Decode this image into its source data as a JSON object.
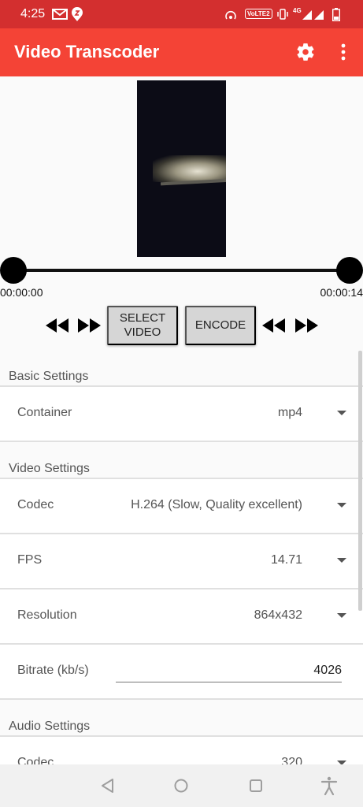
{
  "status_bar": {
    "time": "4:25",
    "volte_badge": "VoLTE2",
    "network_label": "4G"
  },
  "app_bar": {
    "title": "Video Transcoder",
    "settings_icon": "gear-icon",
    "overflow_icon": "more-vert-icon"
  },
  "player": {
    "start_time": "00:00:00",
    "end_time": "00:00:14"
  },
  "controls": {
    "select_video": "SELECT\nVIDEO",
    "encode": "ENCODE"
  },
  "basic_settings": {
    "header": "Basic Settings",
    "container": {
      "label": "Container",
      "value": "mp4"
    }
  },
  "video_settings": {
    "header": "Video Settings",
    "codec": {
      "label": "Codec",
      "value": "H.264 (Slow, Quality excellent)"
    },
    "fps": {
      "label": "FPS",
      "value": "14.71"
    },
    "resolution": {
      "label": "Resolution",
      "value": "864x432"
    },
    "bitrate": {
      "label": "Bitrate (kb/s)",
      "value": "4026"
    }
  },
  "audio_settings": {
    "header": "Audio Settings",
    "codec": {
      "label": "Codec",
      "value": "320"
    }
  },
  "colors": {
    "status_bar": "#d32f2f",
    "app_bar": "#f44336",
    "button": "#d6d6d6"
  }
}
